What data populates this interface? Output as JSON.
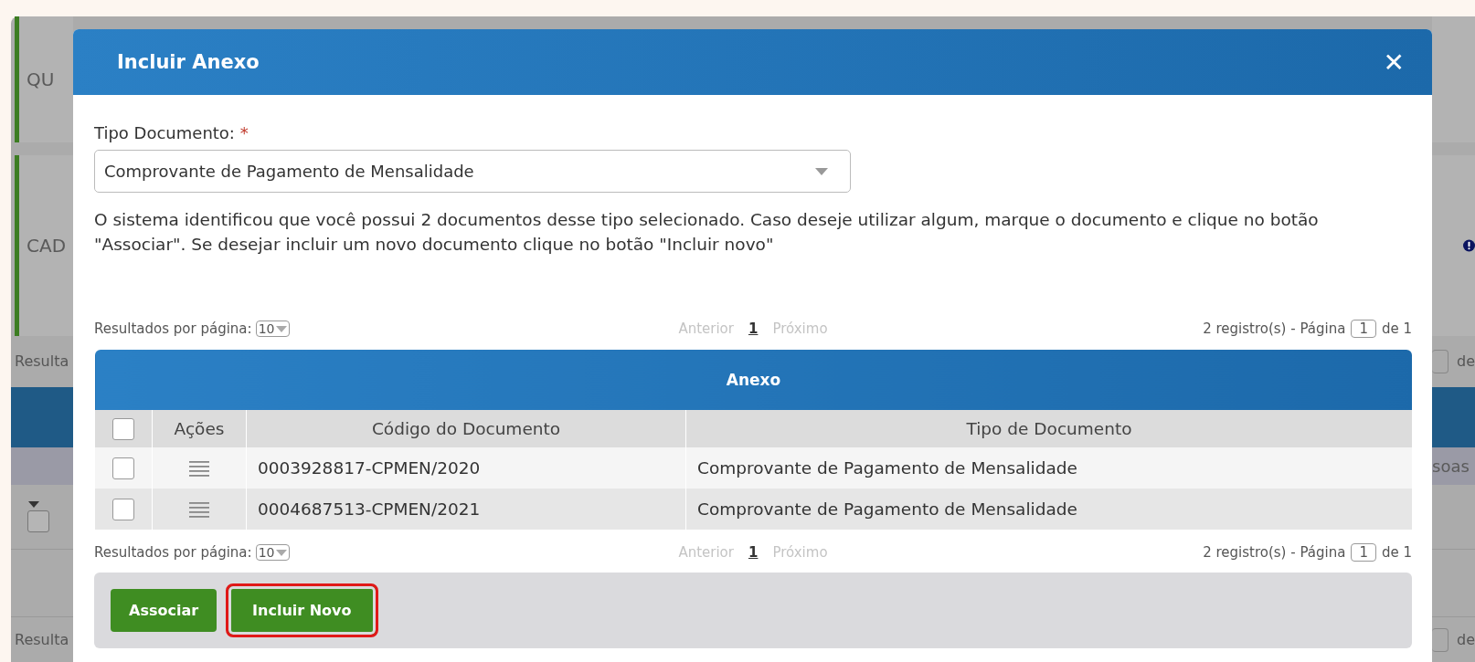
{
  "background": {
    "left": {
      "card_1": "QU",
      "card_2": "CAD",
      "results_top": "Resulta",
      "checkbox": {
        "checked": false
      },
      "results_bottom": "Resulta"
    },
    "right": {
      "results_top": "de",
      "row_text": "soas",
      "results_bottom": "de"
    }
  },
  "dialog": {
    "title": "Incluir Anexo",
    "close": "✕",
    "field": {
      "label": "Tipo Documento:",
      "required": "*",
      "value": "Comprovante de Pagamento de Mensalidade"
    },
    "message": "O sistema identificou que você possui 2 documentos desse tipo selecionado. Caso deseje utilizar algum, marque o documento e clique no botão \"Associar\". Se desejar incluir um novo documento clique no botão \"Incluir novo\"",
    "pagers": [
      {
        "label": "Resultados por página:",
        "per_page": "10",
        "prev": "Anterior",
        "pages": [
          {
            "label": "1",
            "selected": true
          }
        ],
        "next": "Próximo",
        "count": "2 registro(s) - Página",
        "page": "1",
        "of": "de 1"
      },
      {
        "label": "Resultados por página:",
        "per_page": "10",
        "prev": "Anterior",
        "pages": [
          {
            "label": "1",
            "selected": true
          }
        ],
        "next": "Próximo",
        "count": "2 registro(s) - Página",
        "page": "1",
        "of": "de 1"
      }
    ],
    "table": {
      "title": "Anexo",
      "select_all": {
        "checked": false
      },
      "columns": [
        "Ações",
        "Código do Documento",
        "Tipo de Documento"
      ],
      "rows": [
        {
          "checked": false,
          "code": "0003928817-CPMEN/2020",
          "type": "Comprovante de Pagamento de Mensalidade"
        },
        {
          "checked": false,
          "code": "0004687513-CPMEN/2021",
          "type": "Comprovante de Pagamento de Mensalidade"
        }
      ]
    },
    "buttons": [
      {
        "label": "Associar",
        "highlighted": false
      },
      {
        "label": "Incluir Novo",
        "highlighted": true
      }
    ]
  }
}
